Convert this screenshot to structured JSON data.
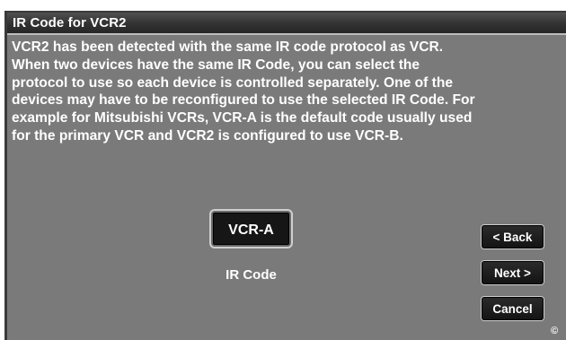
{
  "dialog": {
    "title": "IR Code for VCR2",
    "message_lines": [
      "VCR2 has been detected with the same IR code protocol as VCR.",
      "When two devices have the same IR Code, you can select the",
      "protocol to use so each device is controlled separately. One of the",
      "devices may have to be reconfigured to use the selected IR Code.  For",
      "example for Mitsubishi VCRs, VCR-A is the default code usually used",
      "for the primary VCR and VCR2 is configured to use VCR-B."
    ],
    "ir_code": {
      "value": "VCR-A",
      "caption": "IR Code"
    },
    "buttons": {
      "back": "< Back",
      "next": "Next >",
      "cancel": "Cancel"
    },
    "copyright_symbol": "©"
  }
}
